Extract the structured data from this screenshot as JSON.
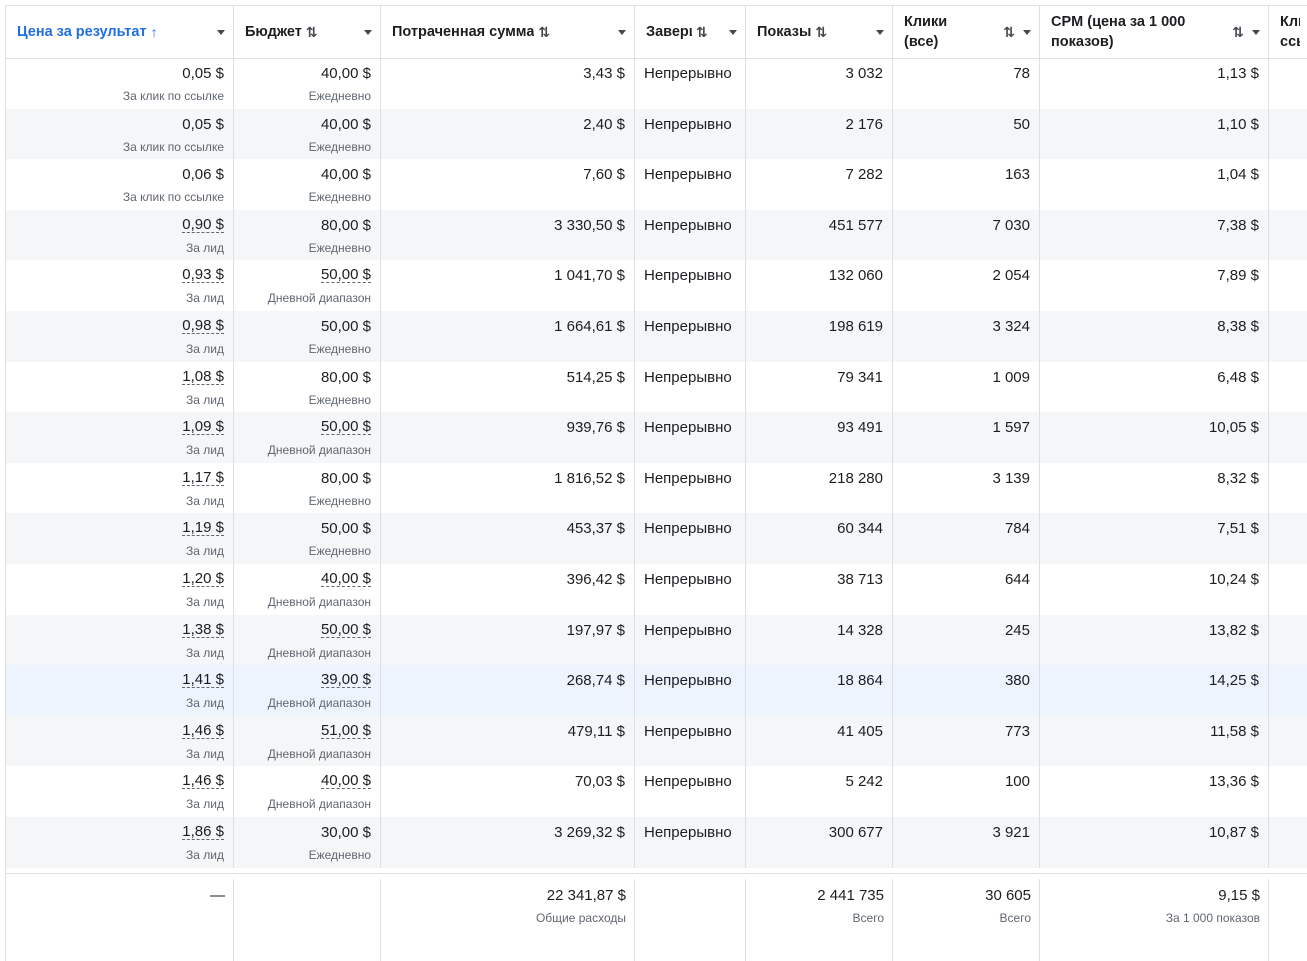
{
  "columns": [
    {
      "label": "Цена за результат",
      "sort": "↑"
    },
    {
      "label": "Бюджет",
      "sort": "⇅"
    },
    {
      "label": "Потраченная сумма",
      "sort": "⇅"
    },
    {
      "label": "Заверш",
      "sort": "⇅"
    },
    {
      "label": "Показы",
      "sort": "⇅"
    },
    {
      "label": "Клики (все)",
      "sort": "⇅"
    },
    {
      "label": "CPM (цена за 1 000 показов)",
      "sort": "⇅"
    },
    {
      "label": "Кли ссы",
      "sort": ""
    }
  ],
  "rows": [
    {
      "cost": "0,05 $",
      "cost_sub": "За клик по ссылке",
      "budget": "40,00 $",
      "budget_sub": "Ежедневно",
      "spent": "3,43 $",
      "end": "Непрерывно",
      "impressions": "3 032",
      "clicks": "78",
      "cpm": "1,13 $"
    },
    {
      "cost": "0,05 $",
      "cost_sub": "За клик по ссылке",
      "budget": "40,00 $",
      "budget_sub": "Ежедневно",
      "spent": "2,40 $",
      "end": "Непрерывно",
      "impressions": "2 176",
      "clicks": "50",
      "cpm": "1,10 $"
    },
    {
      "cost": "0,06 $",
      "cost_sub": "За клик по ссылке",
      "budget": "40,00 $",
      "budget_sub": "Ежедневно",
      "spent": "7,60 $",
      "end": "Непрерывно",
      "impressions": "7 282",
      "clicks": "163",
      "cpm": "1,04 $"
    },
    {
      "cost": "0,90 $",
      "cost_sub": "За лид",
      "budget": "80,00 $",
      "budget_sub": "Ежедневно",
      "spent": "3 330,50 $",
      "end": "Непрерывно",
      "impressions": "451 577",
      "clicks": "7 030",
      "cpm": "7,38 $"
    },
    {
      "cost": "0,93 $",
      "cost_sub": "За лид",
      "budget": "50,00 $",
      "budget_sub": "Дневной диапазон",
      "spent": "1 041,70 $",
      "end": "Непрерывно",
      "impressions": "132 060",
      "clicks": "2 054",
      "cpm": "7,89 $"
    },
    {
      "cost": "0,98 $",
      "cost_sub": "За лид",
      "budget": "50,00 $",
      "budget_sub": "Ежедневно",
      "spent": "1 664,61 $",
      "end": "Непрерывно",
      "impressions": "198 619",
      "clicks": "3 324",
      "cpm": "8,38 $"
    },
    {
      "cost": "1,08 $",
      "cost_sub": "За лид",
      "budget": "80,00 $",
      "budget_sub": "Ежедневно",
      "spent": "514,25 $",
      "end": "Непрерывно",
      "impressions": "79 341",
      "clicks": "1 009",
      "cpm": "6,48 $"
    },
    {
      "cost": "1,09 $",
      "cost_sub": "За лид",
      "budget": "50,00 $",
      "budget_sub": "Дневной диапазон",
      "spent": "939,76 $",
      "end": "Непрерывно",
      "impressions": "93 491",
      "clicks": "1 597",
      "cpm": "10,05 $"
    },
    {
      "cost": "1,17 $",
      "cost_sub": "За лид",
      "budget": "80,00 $",
      "budget_sub": "Ежедневно",
      "spent": "1 816,52 $",
      "end": "Непрерывно",
      "impressions": "218 280",
      "clicks": "3 139",
      "cpm": "8,32 $"
    },
    {
      "cost": "1,19 $",
      "cost_sub": "За лид",
      "budget": "50,00 $",
      "budget_sub": "Ежедневно",
      "spent": "453,37 $",
      "end": "Непрерывно",
      "impressions": "60 344",
      "clicks": "784",
      "cpm": "7,51 $"
    },
    {
      "cost": "1,20 $",
      "cost_sub": "За лид",
      "budget": "40,00 $",
      "budget_sub": "Дневной диапазон",
      "spent": "396,42 $",
      "end": "Непрерывно",
      "impressions": "38 713",
      "clicks": "644",
      "cpm": "10,24 $"
    },
    {
      "cost": "1,38 $",
      "cost_sub": "За лид",
      "budget": "50,00 $",
      "budget_sub": "Дневной диапазон",
      "spent": "197,97 $",
      "end": "Непрерывно",
      "impressions": "14 328",
      "clicks": "245",
      "cpm": "13,82 $"
    },
    {
      "cost": "1,41 $",
      "cost_sub": "За лид",
      "budget": "39,00 $",
      "budget_sub": "Дневной диапазон",
      "spent": "268,74 $",
      "end": "Непрерывно",
      "impressions": "18 864",
      "clicks": "380",
      "cpm": "14,25 $"
    },
    {
      "cost": "1,46 $",
      "cost_sub": "За лид",
      "budget": "51,00 $",
      "budget_sub": "Дневной диапазон",
      "spent": "479,11 $",
      "end": "Непрерывно",
      "impressions": "41 405",
      "clicks": "773",
      "cpm": "11,58 $"
    },
    {
      "cost": "1,46 $",
      "cost_sub": "За лид",
      "budget": "40,00 $",
      "budget_sub": "Дневной диапазон",
      "spent": "70,03 $",
      "end": "Непрерывно",
      "impressions": "5 242",
      "clicks": "100",
      "cpm": "13,36 $"
    },
    {
      "cost": "1,86 $",
      "cost_sub": "За лид",
      "budget": "30,00 $",
      "budget_sub": "Ежедневно",
      "spent": "3 269,32 $",
      "end": "Непрерывно",
      "impressions": "300 677",
      "clicks": "3 921",
      "cpm": "10,87 $"
    }
  ],
  "totals": {
    "cost": "—",
    "spent": "22 341,87 $",
    "spent_sub": "Общие расходы",
    "impressions": "2 441 735",
    "impressions_sub": "Всего",
    "clicks": "30 605",
    "clicks_sub": "Всего",
    "cpm": "9,15 $",
    "cpm_sub": "За 1 000 показов"
  },
  "colors": {
    "accent": "#216fdb",
    "row_alt": "#f5f6f7",
    "row_highlight": "#eef4fd",
    "border": "#dddfe2"
  }
}
